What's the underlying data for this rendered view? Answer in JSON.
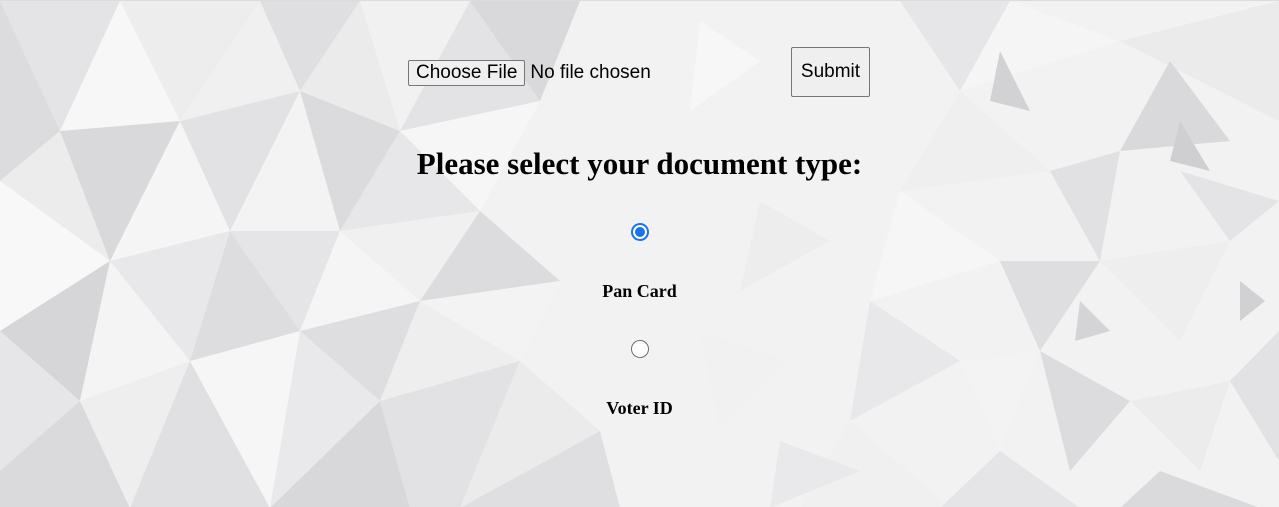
{
  "upload": {
    "choose_file_label": "Choose File",
    "file_status": "No file chosen",
    "submit_label": "Submit"
  },
  "form": {
    "heading": "Please select your document type:",
    "options": [
      {
        "label": "Pan Card",
        "selected": true
      },
      {
        "label": "Voter ID",
        "selected": false
      }
    ]
  },
  "colors": {
    "accent": "#1a73e8",
    "background": "#f4f4f5"
  }
}
